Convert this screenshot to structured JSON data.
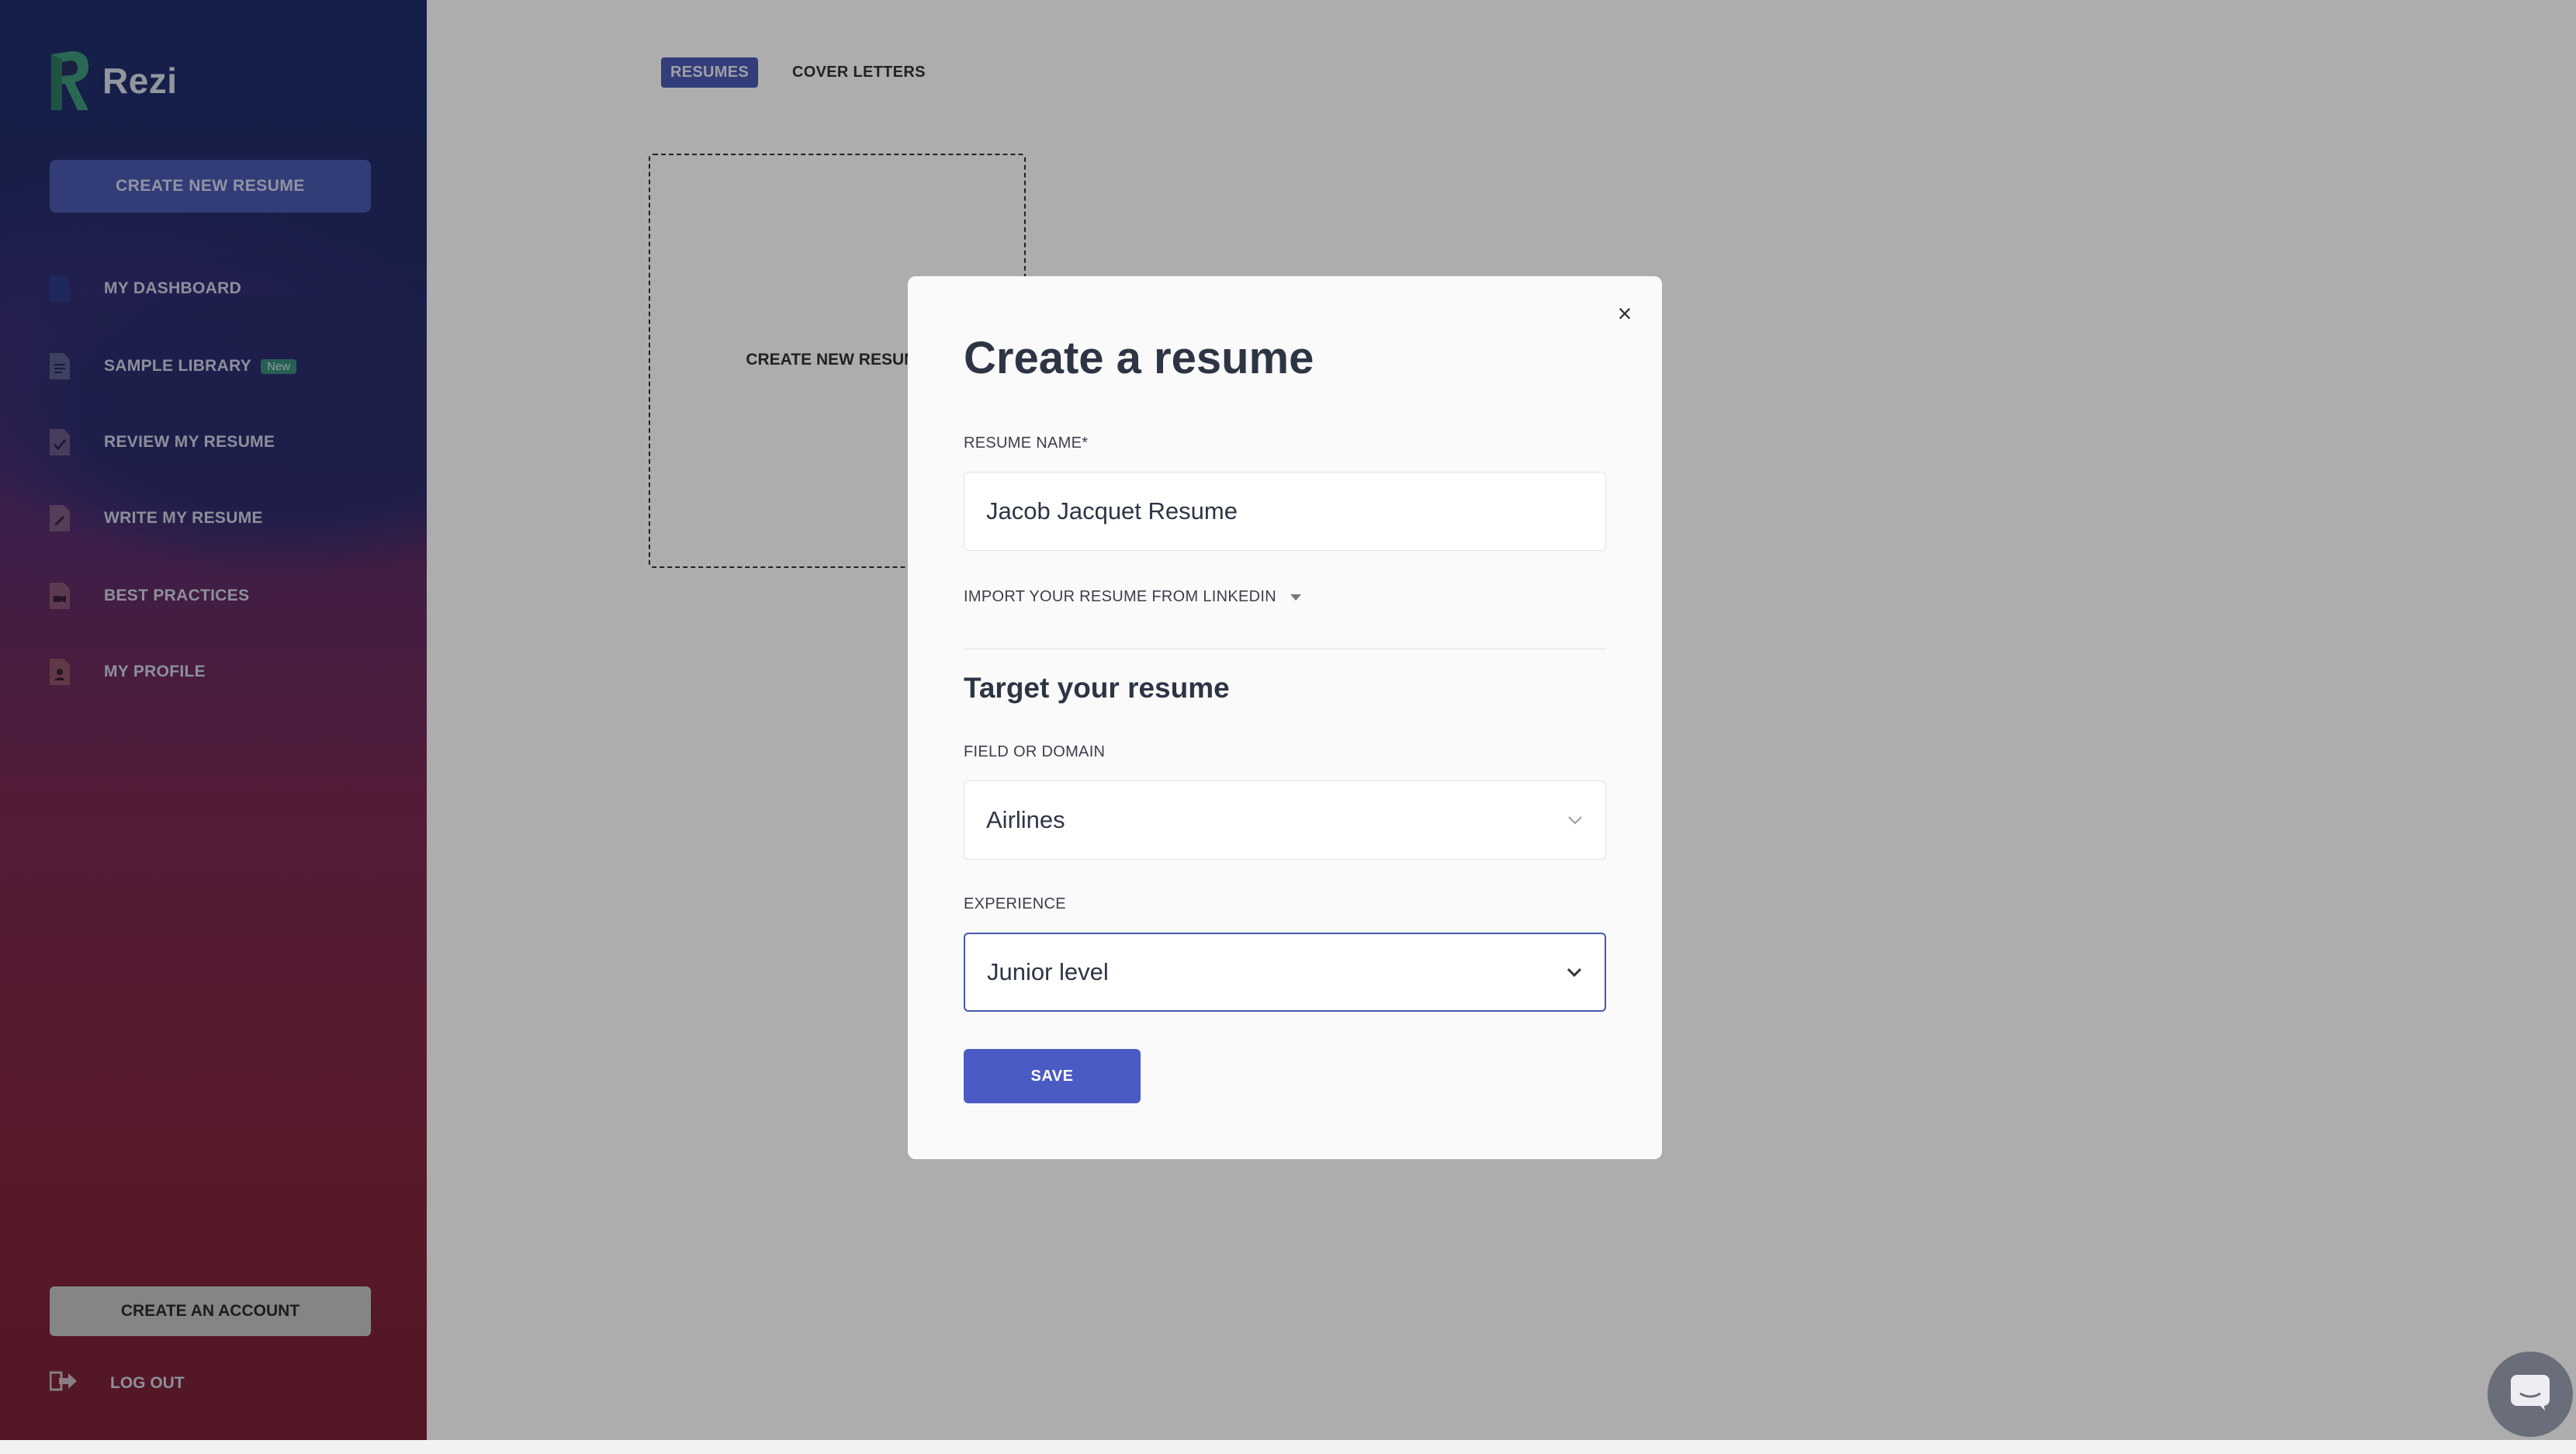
{
  "app": {
    "name": "Rezi"
  },
  "sidebar": {
    "create_button": "CREATE NEW RESUME",
    "items": [
      {
        "label": "MY DASHBOARD",
        "icon": "document-icon"
      },
      {
        "label": "SAMPLE LIBRARY",
        "icon": "document-lines-icon",
        "badge": "New"
      },
      {
        "label": "REVIEW MY RESUME",
        "icon": "document-check-icon"
      },
      {
        "label": "WRITE MY RESUME",
        "icon": "document-pen-icon"
      },
      {
        "label": "BEST PRACTICES",
        "icon": "document-video-icon"
      },
      {
        "label": "MY PROFILE",
        "icon": "document-person-icon"
      }
    ],
    "account_button": "CREATE AN ACCOUNT",
    "logout": "LOG OUT"
  },
  "main": {
    "tabs": [
      {
        "label": "RESUMES",
        "active": true
      },
      {
        "label": "COVER LETTERS",
        "active": false
      }
    ],
    "new_card_label": "CREATE NEW RESUME"
  },
  "modal": {
    "title": "Create a resume",
    "resume_name_label": "RESUME NAME*",
    "resume_name_value": "Jacob Jacquet Resume",
    "linkedin_toggle": "IMPORT YOUR RESUME FROM LINKEDIN",
    "section_title": "Target your resume",
    "field_label": "FIELD OR DOMAIN",
    "field_value": "Airlines",
    "experience_label": "EXPERIENCE",
    "experience_value": "Junior level",
    "save_button": "SAVE",
    "close_symbol": "×"
  },
  "colors": {
    "accent": "#4a5bc4",
    "sidebar_top": "#1d2f6c",
    "sidebar_bottom": "#7b2136",
    "badge_new": "#3c8d7e"
  }
}
